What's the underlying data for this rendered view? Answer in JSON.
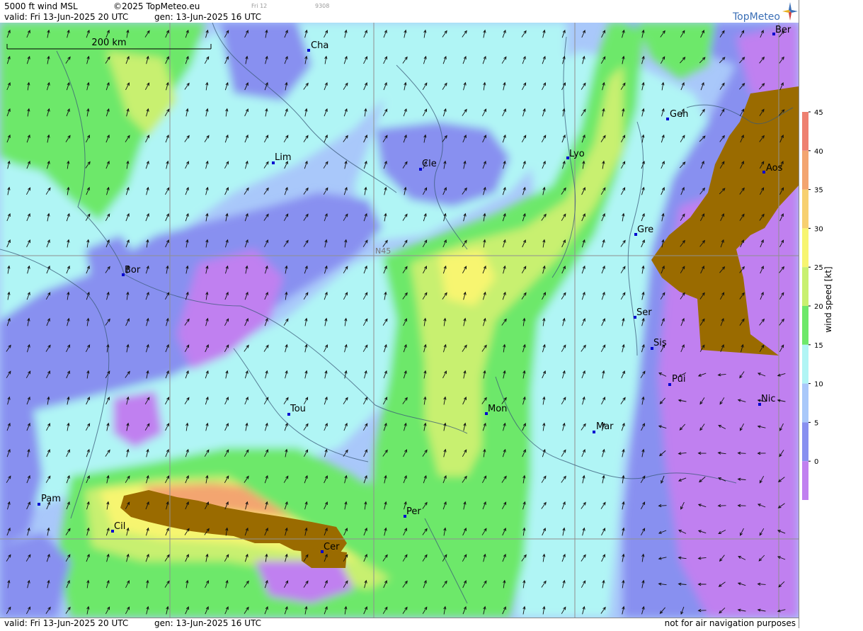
{
  "header": {
    "line1_left": "5000 ft wind MSL",
    "copyright": "©2025 TopMeteo.eu",
    "day_small": "Fri 12",
    "code_small": "9308",
    "valid": "valid:  Fri  13-Jun-2025  20 UTC",
    "gen": "gen: 13-Jun-2025 16 UTC"
  },
  "logo": {
    "text": "TopMeteo"
  },
  "scale_bar": {
    "label": "200 km"
  },
  "grid": {
    "lat_label": "N45"
  },
  "footer": {
    "valid": "valid:  Fri  13-Jun-2025  20 UTC",
    "gen": "gen: 13-Jun-2025 16 UTC",
    "disclaimer": "not for air navigation purposes"
  },
  "legend": {
    "title": "wind  speed  [kt]",
    "ticks": [
      "45",
      "40",
      "35",
      "30",
      "25",
      "20",
      "15",
      "10",
      "5",
      "0"
    ],
    "colors": [
      "#ee8070",
      "#f3a570",
      "#f7d070",
      "#f7f570",
      "#c8f070",
      "#6de86a",
      "#b0f5f5",
      "#a9c8fa",
      "#8890f0",
      "#c080f0"
    ]
  },
  "cities": [
    {
      "name": "Ber"
    },
    {
      "name": "Cha"
    },
    {
      "name": "Gen"
    },
    {
      "name": "Lim"
    },
    {
      "name": "Cle"
    },
    {
      "name": "Lyo"
    },
    {
      "name": "Aos"
    },
    {
      "name": "Gre"
    },
    {
      "name": "Bor"
    },
    {
      "name": "Ser"
    },
    {
      "name": "Sis"
    },
    {
      "name": "Pui"
    },
    {
      "name": "Tou"
    },
    {
      "name": "Mon"
    },
    {
      "name": "Mar"
    },
    {
      "name": "Nic"
    },
    {
      "name": "Pam"
    },
    {
      "name": "Per"
    },
    {
      "name": "Cil"
    },
    {
      "name": "Cer"
    }
  ],
  "colors": {
    "calm": "#c080f0",
    "w5": "#8890f0",
    "w10": "#a9c8fa",
    "w15": "#b0f5f5",
    "w20": "#6de86a",
    "w25": "#c8f070",
    "w30": "#f7f570",
    "w35": "#f7d070",
    "w40": "#f3a570",
    "terrain": "#9a6b00"
  }
}
